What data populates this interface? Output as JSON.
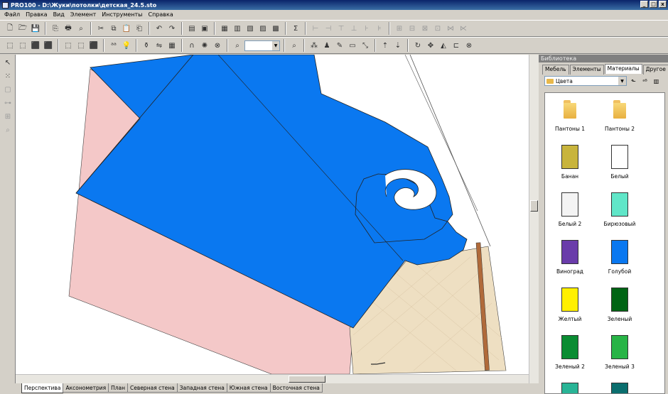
{
  "window": {
    "title": "PRO100 - D:\\Жуки\\потолки\\детская_24.5.sto",
    "controls": [
      "_",
      "□",
      "x"
    ]
  },
  "menu": [
    "Файл",
    "Правка",
    "Вид",
    "Элемент",
    "Инструменты",
    "Справка"
  ],
  "toolbar1": {
    "groups": [
      [
        "new-icon",
        "open-icon",
        "save-icon"
      ],
      [
        "save-as-icon",
        "print-icon",
        "print-preview-icon"
      ],
      [
        "cut-icon",
        "copy-icon",
        "paste-icon",
        "paste-special-icon"
      ],
      [
        "undo-icon",
        "redo-icon"
      ],
      [
        "properties-icon",
        "info-icon"
      ],
      [
        "view-1-icon",
        "view-2-icon",
        "view-3-icon",
        "view-4-icon",
        "view-5-icon"
      ],
      [
        "sum-icon"
      ],
      [
        "align-left-icon",
        "align-center-icon",
        "align-right-icon",
        "align-top-icon",
        "align-middle-icon",
        "align-bottom-icon"
      ],
      [
        "distribute-1-icon",
        "distribute-2-icon",
        "distribute-3-icon",
        "distribute-4-icon",
        "distribute-5-icon",
        "distribute-6-icon"
      ]
    ],
    "glyphs": {
      "new-icon": "🗋",
      "open-icon": "🗁",
      "save-icon": "💾",
      "save-as-icon": "⎘",
      "print-icon": "🖶",
      "print-preview-icon": "⌕",
      "cut-icon": "✂",
      "copy-icon": "⧉",
      "paste-icon": "📋",
      "paste-special-icon": "⎗",
      "undo-icon": "↶",
      "redo-icon": "↷",
      "properties-icon": "▤",
      "info-icon": "▣",
      "view-1-icon": "▦",
      "view-2-icon": "▥",
      "view-3-icon": "▧",
      "view-4-icon": "▨",
      "view-5-icon": "▩",
      "sum-icon": "Σ",
      "align-left-icon": "⊢",
      "align-center-icon": "⊣",
      "align-right-icon": "⊤",
      "align-top-icon": "⊥",
      "align-middle-icon": "⊦",
      "align-bottom-icon": "⊧",
      "distribute-1-icon": "⊞",
      "distribute-2-icon": "⊟",
      "distribute-3-icon": "⊠",
      "distribute-4-icon": "⊡",
      "distribute-5-icon": "⋈",
      "distribute-6-icon": "⋉"
    },
    "dim_from_group": 7
  },
  "toolbar2": {
    "groups": [
      [
        "cube-1-icon",
        "cube-2-icon",
        "cube-3-icon",
        "cube-4-icon"
      ],
      [
        "cube-5-icon",
        "cube-6-icon",
        "cube-7-icon"
      ],
      [
        "text-icon",
        "light-icon"
      ],
      [
        "brush-icon",
        "texture-icon",
        "grid-icon"
      ],
      [
        "magnet-icon",
        "snap-icon",
        "stop-icon"
      ],
      [
        "zoom-icon"
      ],
      [
        "zoom-fit-icon"
      ],
      [
        "select-points-icon",
        "move-icon",
        "draw-icon",
        "select-icon",
        "scale-icon"
      ],
      [
        "move-up-icon",
        "move-down-icon"
      ],
      [
        "rotate-icon",
        "pan-icon",
        "mirror-icon",
        "dimension-icon",
        "no-icon"
      ]
    ],
    "glyphs": {
      "cube-1-icon": "⬚",
      "cube-2-icon": "⬚",
      "cube-3-icon": "⬛",
      "cube-4-icon": "⬛",
      "cube-5-icon": "⬚",
      "cube-6-icon": "⬚",
      "cube-7-icon": "⬛",
      "text-icon": "ᵃᵃ",
      "light-icon": "💡",
      "brush-icon": "⚱",
      "texture-icon": "⇋",
      "grid-icon": "▦",
      "magnet-icon": "∩",
      "snap-icon": "✺",
      "stop-icon": "⊗",
      "zoom-icon": "⌕",
      "zoom-fit-icon": "⌕",
      "select-points-icon": "⁂",
      "move-icon": "♟",
      "draw-icon": "✎",
      "select-icon": "▭",
      "scale-icon": "⤡",
      "move-up-icon": "⇡",
      "move-down-icon": "⇣",
      "rotate-icon": "↻",
      "pan-icon": "✥",
      "mirror-icon": "◭",
      "dimension-icon": "⊏",
      "no-icon": "⊗"
    },
    "zoom_value": ""
  },
  "left_tools": {
    "items": [
      "pointer-icon",
      "multi-select-icon",
      "box-icon",
      "link-icon",
      "group-icon",
      "zoom-tool-icon"
    ],
    "glyphs": {
      "pointer-icon": "↖",
      "multi-select-icon": "⁙",
      "box-icon": "▢",
      "link-icon": "⊶",
      "group-icon": "⊞",
      "zoom-tool-icon": "⌕"
    }
  },
  "view_tabs": [
    "Перспектива",
    "Аксонометрия",
    "План",
    "Северная стена",
    "Западная стена",
    "Южная стена",
    "Восточная стена"
  ],
  "active_view_tab": 0,
  "library": {
    "title": "Библиотека",
    "tabs": [
      "Мебель",
      "Элементы",
      "Материалы",
      "Другое"
    ],
    "active_tab": 2,
    "folder": "Цвета",
    "items": [
      {
        "label": "Пантоны 1",
        "kind": "folder"
      },
      {
        "label": "Пантоны 2",
        "kind": "folder"
      },
      {
        "label": "Банан",
        "kind": "color",
        "color": "#c8b43c"
      },
      {
        "label": "Белый",
        "kind": "color",
        "color": "#ffffff"
      },
      {
        "label": "Белый 2",
        "kind": "color",
        "color": "#f4f4f4"
      },
      {
        "label": "Бирюзовый",
        "kind": "color",
        "color": "#60e6c8"
      },
      {
        "label": "Виноград",
        "kind": "color",
        "color": "#6a3caa"
      },
      {
        "label": "Голубой",
        "kind": "color",
        "color": "#0a78f0"
      },
      {
        "label": "Желтый",
        "kind": "color",
        "color": "#fff000"
      },
      {
        "label": "Зеленый",
        "kind": "color",
        "color": "#006414"
      },
      {
        "label": "Зеленый 2",
        "kind": "color",
        "color": "#0a8c32"
      },
      {
        "label": "Зеленый 3",
        "kind": "color",
        "color": "#28b446"
      },
      {
        "label": "",
        "kind": "color",
        "color": "#28b496"
      },
      {
        "label": "",
        "kind": "color",
        "color": "#0a6e6e"
      }
    ]
  },
  "scene_colors": {
    "ceiling": "#0a78f0",
    "wall_pink": "#f4c8c8",
    "wall_tiles": "#eedfc2",
    "white_border": "#ffffff"
  }
}
